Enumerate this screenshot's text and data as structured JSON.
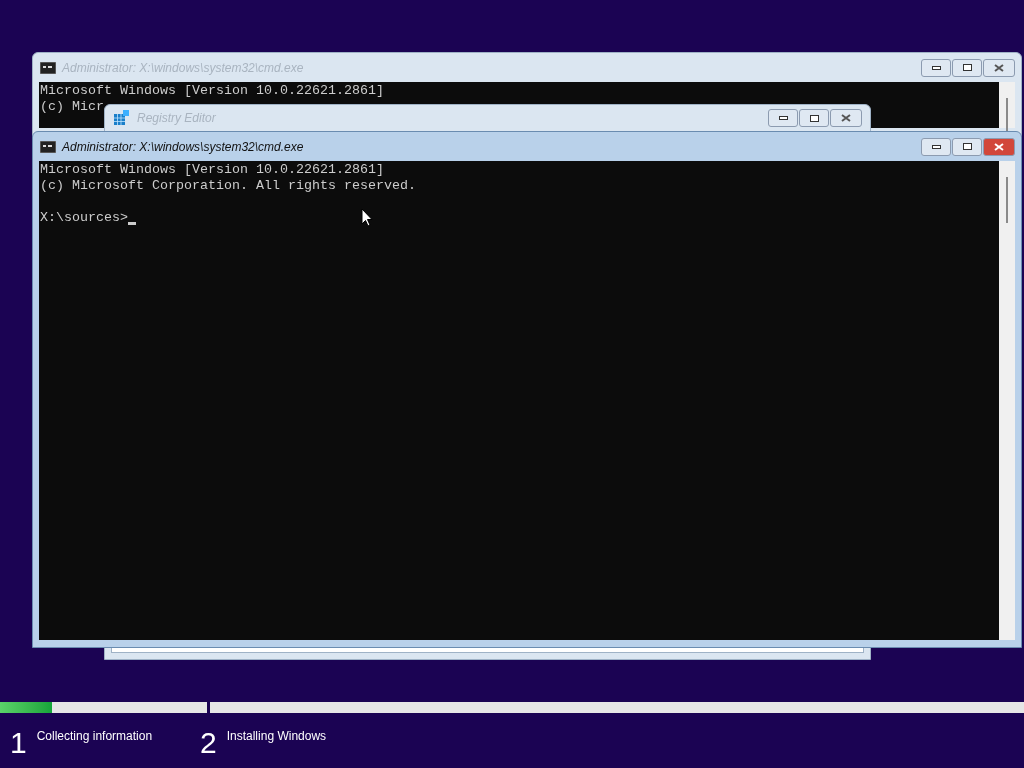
{
  "windows": [
    {
      "kind": "console",
      "title": "Administrator: X:\\windows\\system32\\cmd.exe",
      "active": false,
      "lines": [
        "Microsoft Windows [Version 10.0.22621.2861]",
        "(c) Micr"
      ]
    },
    {
      "kind": "regedit",
      "title": "Registry Editor",
      "active": false
    },
    {
      "kind": "console",
      "title": "Administrator: X:\\windows\\system32\\cmd.exe",
      "active": true,
      "lines": [
        "Microsoft Windows [Version 10.0.22621.2861]",
        "(c) Microsoft Corporation. All rights reserved."
      ],
      "prompt": "X:\\sources>"
    }
  ],
  "steps": [
    {
      "number": "1",
      "label": "Collecting information",
      "level": 0.25
    },
    {
      "number": "2",
      "label": "Installing Windows"
    }
  ]
}
